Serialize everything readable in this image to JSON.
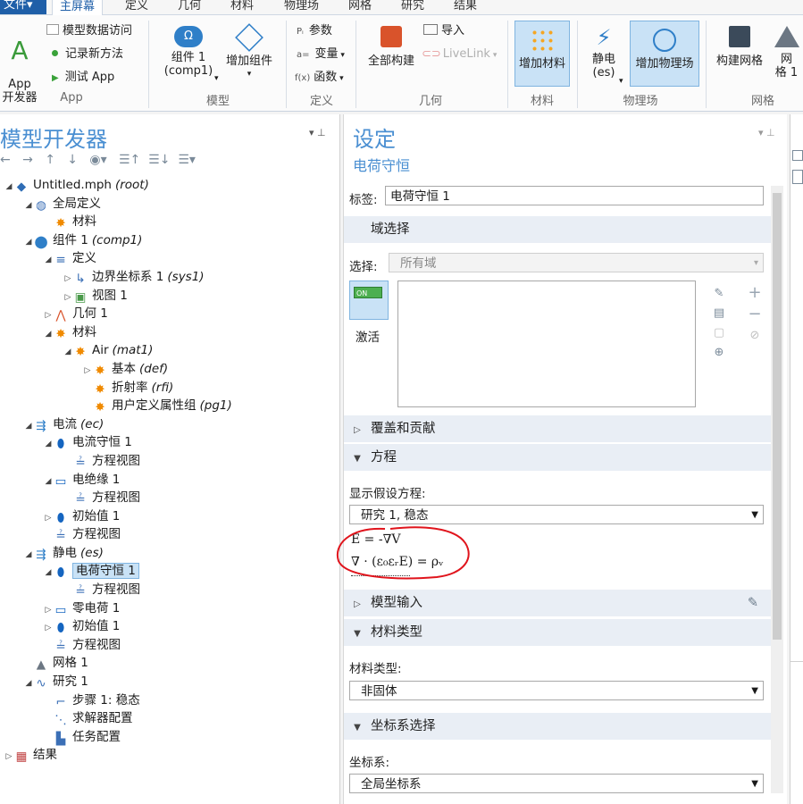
{
  "ribbon": {
    "file_menu": "文件▾",
    "tabs": [
      "主屏幕",
      "定义",
      "几何",
      "材料",
      "物理场",
      "网格",
      "研究",
      "结果"
    ],
    "app": {
      "big_button": "App\n开发器",
      "model_data_access": "模型数据访问",
      "record_method": "记录新方法",
      "test_app": "测试 App",
      "group": "App"
    },
    "model": {
      "component": "组件 1\n(comp1)",
      "add_component": "增加组件",
      "group": "模型"
    },
    "definitions": {
      "parameters": "参数",
      "variables": "变量",
      "functions": "函数",
      "group": "定义"
    },
    "geometry": {
      "build_all": "全部构建",
      "import": "导入",
      "livelink": "LiveLink",
      "group": "几何"
    },
    "materials": {
      "add_material": "增加材料",
      "group": "材料"
    },
    "physics": {
      "electrostatics": "静电\n(es)",
      "add_physics": "增加物理场",
      "group": "物理场"
    },
    "mesh": {
      "build_mesh": "构建网格",
      "mesh1": "网\n格 1",
      "group": "网格"
    }
  },
  "model_builder": {
    "title": "模型开发器",
    "tree": [
      {
        "label": "Untitled.mph",
        "tag": "(root)",
        "toggle": "◢"
      },
      {
        "label": "全局定义",
        "tag": "",
        "toggle": "◢"
      },
      {
        "label": "材料",
        "tag": "",
        "toggle": ""
      },
      {
        "label": "组件 1",
        "tag": "(comp1)",
        "toggle": "◢"
      },
      {
        "label": "定义",
        "tag": "",
        "toggle": "◢"
      },
      {
        "label": "边界坐标系 1",
        "tag": "(sys1)",
        "toggle": "▷"
      },
      {
        "label": "视图 1",
        "tag": "",
        "toggle": "▷"
      },
      {
        "label": "几何 1",
        "tag": "",
        "toggle": "▷"
      },
      {
        "label": "材料",
        "tag": "",
        "toggle": "◢"
      },
      {
        "label": "Air",
        "tag": "(mat1)",
        "toggle": "◢"
      },
      {
        "label": "基本",
        "tag": "(def)",
        "toggle": "▷"
      },
      {
        "label": "折射率",
        "tag": "(rfi)",
        "toggle": ""
      },
      {
        "label": "用户定义属性组",
        "tag": "(pg1)",
        "toggle": ""
      },
      {
        "label": "电流",
        "tag": "(ec)",
        "toggle": "◢"
      },
      {
        "label": "电流守恒 1",
        "tag": "",
        "toggle": "◢"
      },
      {
        "label": "方程视图",
        "tag": "",
        "toggle": ""
      },
      {
        "label": "电绝缘 1",
        "tag": "",
        "toggle": "◢"
      },
      {
        "label": "方程视图",
        "tag": "",
        "toggle": ""
      },
      {
        "label": "初始值 1",
        "tag": "",
        "toggle": "▷"
      },
      {
        "label": "方程视图",
        "tag": "",
        "toggle": ""
      },
      {
        "label": "静电",
        "tag": "(es)",
        "toggle": "◢"
      },
      {
        "label": "电荷守恒 1",
        "tag": "",
        "toggle": "◢"
      },
      {
        "label": "方程视图",
        "tag": "",
        "toggle": ""
      },
      {
        "label": "零电荷 1",
        "tag": "",
        "toggle": "▷"
      },
      {
        "label": "初始值 1",
        "tag": "",
        "toggle": "▷"
      },
      {
        "label": "方程视图",
        "tag": "",
        "toggle": ""
      },
      {
        "label": "网格 1",
        "tag": "",
        "toggle": ""
      },
      {
        "label": "研究 1",
        "tag": "",
        "toggle": "◢"
      },
      {
        "label": "步骤 1: 稳态",
        "tag": "",
        "toggle": ""
      },
      {
        "label": "求解器配置",
        "tag": "",
        "toggle": ""
      },
      {
        "label": "任务配置",
        "tag": "",
        "toggle": ""
      },
      {
        "label": "结果",
        "tag": "",
        "toggle": "▷"
      }
    ]
  },
  "settings": {
    "title": "设定",
    "subtitle": "电荷守恒",
    "label_field_label": "标签:",
    "label_value": "电荷守恒 1",
    "domain_section": "域选择",
    "selection_label": "选择:",
    "selection_value": "所有域",
    "active_label": "激活",
    "toggle_text": "ON",
    "override_section": "覆盖和贡献",
    "equation_section": "方程",
    "show_equation_label": "显示假设方程:",
    "study_value": "研究 1, 稳态",
    "eq1": "E = -∇V",
    "eq2": "∇ · (ε₀εᵣE) = ρᵥ",
    "model_input_section": "模型输入",
    "material_type_section": "材料类型",
    "material_type_label": "材料类型:",
    "material_type_value": "非固体",
    "coord_section": "坐标系选择",
    "coord_label": "坐标系:",
    "coord_value": "全局坐标系"
  },
  "colors": {
    "accent": "#4a8fd2",
    "annotation": "#e0141c",
    "highlight": "#c9e2f6"
  }
}
